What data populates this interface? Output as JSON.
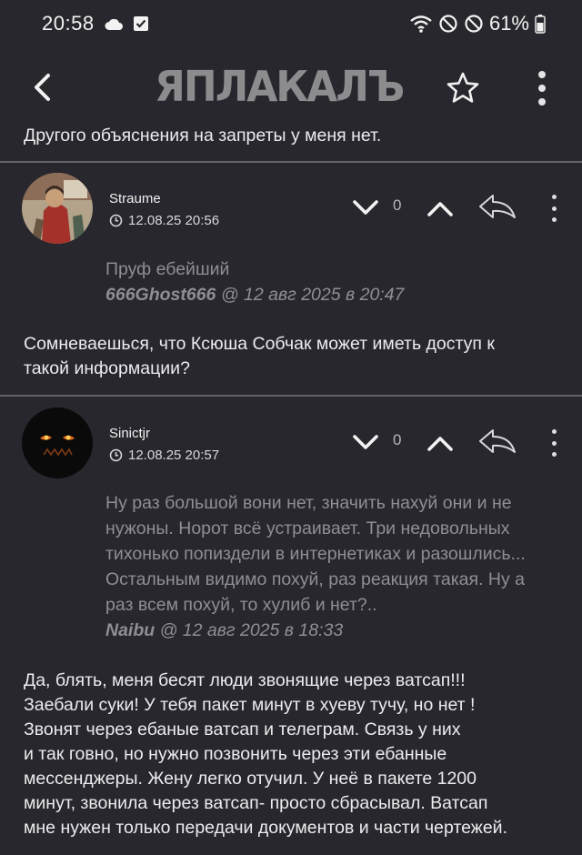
{
  "status_bar": {
    "time": "20:58",
    "battery": "61%"
  },
  "top_bar": {
    "logo_text": "ЯПЛАКАЛЪ"
  },
  "top_text": "Другого объяснения на запреты у меня нет.",
  "posts": [
    {
      "username": "Straume",
      "date": "12.08.25 20:56",
      "vote_count": "0",
      "quote_lines": [
        "Пруф ебейший"
      ],
      "quote_author": "666Ghost666",
      "quote_date": " @ 12 авг 2025 в 20:47",
      "body_lines": [
        "Сомневаешься, что Ксюша Собчак может иметь доступ к",
        "такой информации?"
      ]
    },
    {
      "username": "Sinictjr",
      "date": "12.08.25 20:57",
      "vote_count": "0",
      "quote_lines": [
        "Ну раз большой вони нет, значить нахуй они и не",
        "нужоны. Норот всё устраивает. Три недовольных",
        "тихонько попиздели в интернетиках и разошлись...",
        "Остальным видимо похуй, раз реакция такая. Ну а",
        "раз всем похуй, то хулиб и нет?.."
      ],
      "quote_author": "Naibu",
      "quote_date": " @ 12 авг 2025 в 18:33",
      "body_lines": [
        "Да, блять, меня бесят люди звонящие через ватсап!!!",
        "Заебали суки! У тебя пакет минут в хуеву тучу, но нет !",
        "Звонят через ебаные ватсап и телеграм. Связь у них",
        "и так говно, но нужно позвонить через эти ебанные",
        "мессенджеры. Жену легко отучил. У неё в пакете 1200",
        "минут, звонила через ватсап- просто сбрасывал. Ватсап",
        "мне нужен только передачи документов и части чертежей."
      ]
    }
  ]
}
